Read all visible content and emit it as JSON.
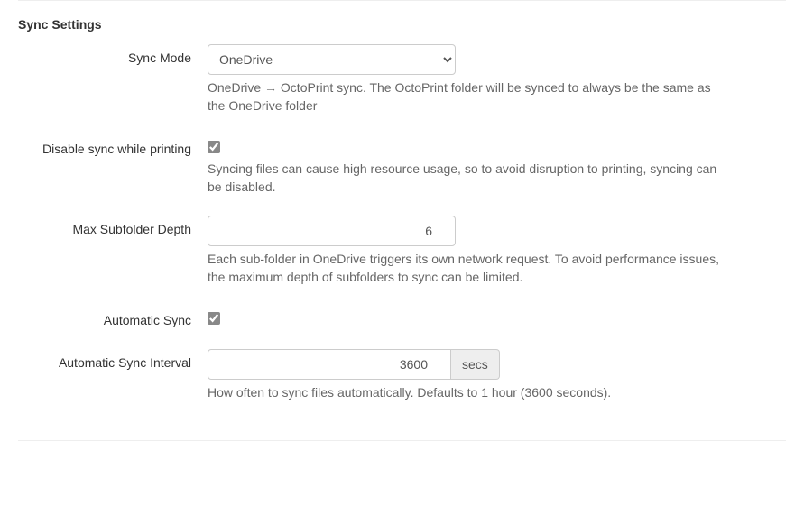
{
  "section": {
    "title": "Sync Settings"
  },
  "fields": {
    "sync_mode": {
      "label": "Sync Mode",
      "value": "OneDrive",
      "help": "OneDrive → OctoPrint sync. The OctoPrint folder will be synced to always be the same as the OneDrive folder"
    },
    "disable_sync": {
      "label": "Disable sync while printing",
      "checked": true,
      "help": "Syncing files can cause high resource usage, so to avoid disruption to printing, syncing can be disabled."
    },
    "max_depth": {
      "label": "Max Subfolder Depth",
      "value": "6",
      "help": "Each sub-folder in OneDrive triggers its own network request. To avoid performance issues, the maximum depth of subfolders to sync can be limited."
    },
    "auto_sync": {
      "label": "Automatic Sync",
      "checked": true
    },
    "interval": {
      "label": "Automatic Sync Interval",
      "value": "3600",
      "unit": "secs",
      "help": "How often to sync files automatically. Defaults to 1 hour (3600 seconds)."
    }
  }
}
